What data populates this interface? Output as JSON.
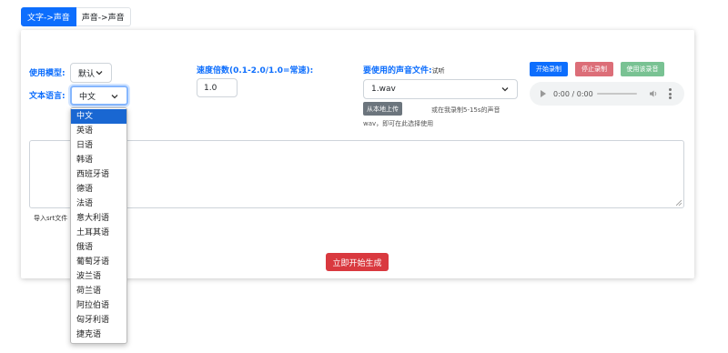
{
  "tabs": [
    {
      "label": "文字->声音",
      "active": true
    },
    {
      "label": "声音->声音",
      "active": false
    }
  ],
  "model": {
    "label": "使用模型:",
    "value": "默认"
  },
  "language": {
    "label": "文本语言:",
    "value": "中文",
    "options": [
      "中文",
      "英语",
      "日语",
      "韩语",
      "西班牙语",
      "德语",
      "法语",
      "意大利语",
      "土耳其语",
      "俄语",
      "葡萄牙语",
      "波兰语",
      "荷兰语",
      "阿拉伯语",
      "匈牙利语",
      "捷克语"
    ]
  },
  "speed": {
    "label": "速度倍数(0.1-2.0/1.0=常速):",
    "value": "1.0"
  },
  "voice": {
    "label": "要使用的声音文件:",
    "hint": "试听",
    "value": "1.wav",
    "upload_label": "从本地上传",
    "upload_hint": "或在我录制5-15s的声音wav，即可在此选择使用"
  },
  "record": {
    "start": "开始录制",
    "stop": "停止录制",
    "use": "使用该录音"
  },
  "audio_player": {
    "time": "0:00 / 0:00"
  },
  "text_input": {
    "value": ""
  },
  "srt_label": "导入srt文件",
  "generate_button": "立即开始生成",
  "colors": {
    "primary": "#0d6efd",
    "danger": "#d9393f",
    "selected_option": "#1967d2"
  }
}
